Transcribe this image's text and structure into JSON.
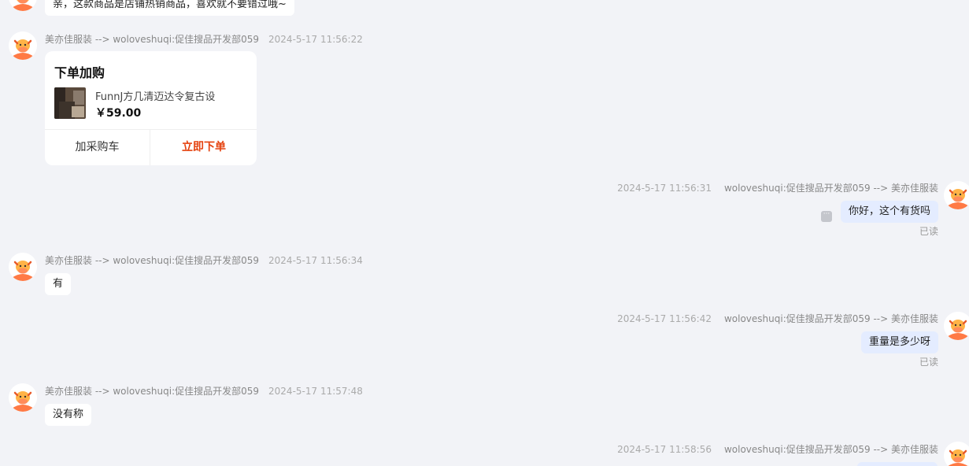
{
  "messages": {
    "m0": {
      "text": "亲，这款商品是店铺热销商品，喜欢就不要错过哦~"
    },
    "m1": {
      "sender": "美亦佳服装 --> woloveshuqi:促佳搜品开发部059",
      "time": "2024-5-17 11:56:22",
      "card": {
        "title": "下单加购",
        "product_name": "FunnJ方几清迈达令复古设",
        "price": "￥59.00",
        "cart_label": "加采购车",
        "buy_label": "立即下单"
      }
    },
    "m2": {
      "sender": "woloveshuqi:促佳搜品开发部059 --> 美亦佳服装",
      "time": "2024-5-17 11:56:31",
      "text": "你好，这个有货吗",
      "status": "已读"
    },
    "m3": {
      "sender": "美亦佳服装 --> woloveshuqi:促佳搜品开发部059",
      "time": "2024-5-17 11:56:34",
      "text": "有"
    },
    "m4": {
      "sender": "woloveshuqi:促佳搜品开发部059 --> 美亦佳服装",
      "time": "2024-5-17 11:56:42",
      "text": "重量是多少呀",
      "status": "已读"
    },
    "m5": {
      "sender": "美亦佳服装 --> woloveshuqi:促佳搜品开发部059",
      "time": "2024-5-17 11:57:48",
      "text": "没有称"
    },
    "m6": {
      "sender": "woloveshuqi:促佳搜品开发部059 --> 美亦佳服装",
      "time": "2024-5-17 11:58:56"
    }
  },
  "icons": {
    "avatar": "cartoon-cow-avatar-icon",
    "more": "more-options-icon"
  },
  "colors": {
    "background": "#f2f3f7",
    "incoming_bubble": "#ffffff",
    "outgoing_bubble": "#e4ecff",
    "buy_button": "#e5420f",
    "avatar_accent": "#ff7a45"
  }
}
